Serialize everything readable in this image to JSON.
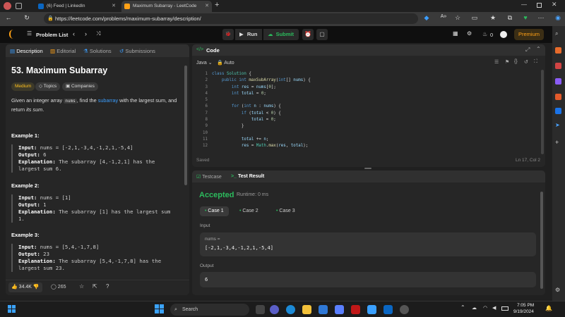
{
  "browser": {
    "tabs": [
      {
        "label": "(6) Feed | LinkedIn"
      },
      {
        "label": "Maximum Subarray - LeetCode"
      }
    ],
    "url": "https://leetcode.com/problems/maximum-subarray/description/"
  },
  "header": {
    "problem_list_label": "Problem List",
    "run_label": "Run",
    "submit_label": "Submit",
    "streak_count": "0",
    "premium_label": "Premium"
  },
  "left_panel": {
    "tabs": [
      "Description",
      "Editorial",
      "Solutions",
      "Submissions"
    ],
    "title": "53. Maximum Subarray",
    "difficulty": "Medium",
    "topics_label": "Topics",
    "companies_label": "Companies",
    "desc_1": "Given an integer array",
    "desc_code": "nums",
    "desc_2": ", find the",
    "desc_link": "subarray",
    "desc_3": "with the largest sum, and",
    "desc_4": "return",
    "desc_5": "its sum",
    "desc_6": ".",
    "examples": [
      {
        "heading": "Example 1:",
        "input": "nums = [-2,1,-3,4,-1,2,1,-5,4]",
        "output": "6",
        "explanation_1": "The subarray [4,-1,2,1] has the",
        "explanation_2": "largest sum 6."
      },
      {
        "heading": "Example 2:",
        "input": "nums = [1]",
        "output": "1",
        "explanation_1": "The subarray [1] has the largest sum",
        "explanation_2": "1."
      },
      {
        "heading": "Example 3:",
        "input": "nums = [5,4,-1,7,8]",
        "output": "23",
        "explanation_1": "The subarray [5,4,-1,7,8] has the",
        "explanation_2": "largest sum 23."
      }
    ],
    "labels": {
      "input": "Input:",
      "output": "Output:",
      "explanation": "Explanation:"
    },
    "likes": "34.4K",
    "comments": "265"
  },
  "code_panel": {
    "title": "Code",
    "language": "Java",
    "mode": "Auto",
    "line_numbers": [
      "1",
      "2",
      "3",
      "4",
      "5",
      "6",
      "7",
      "8",
      "9",
      "10",
      "11",
      "12"
    ],
    "status": "Saved",
    "cursor": "Ln 17, Col 2"
  },
  "result_panel": {
    "testcase_label": "Testcase",
    "result_label": "Test Result",
    "verdict": "Accepted",
    "runtime": "Runtime: 0 ms",
    "cases": [
      "Case 1",
      "Case 2",
      "Case 3"
    ],
    "input_label": "Input",
    "param_name": "nums =",
    "param_value": "[-2,1,-3,4,-1,2,1,-5,4]",
    "output_label": "Output",
    "output_value": "6"
  },
  "taskbar": {
    "search_placeholder": "Search",
    "time": "7:05 PM",
    "date": "9/19/2024"
  },
  "colors": {
    "accent_orange": "#ffa116",
    "accepted_green": "#2cbb5d",
    "link_blue": "#3b9eff"
  }
}
